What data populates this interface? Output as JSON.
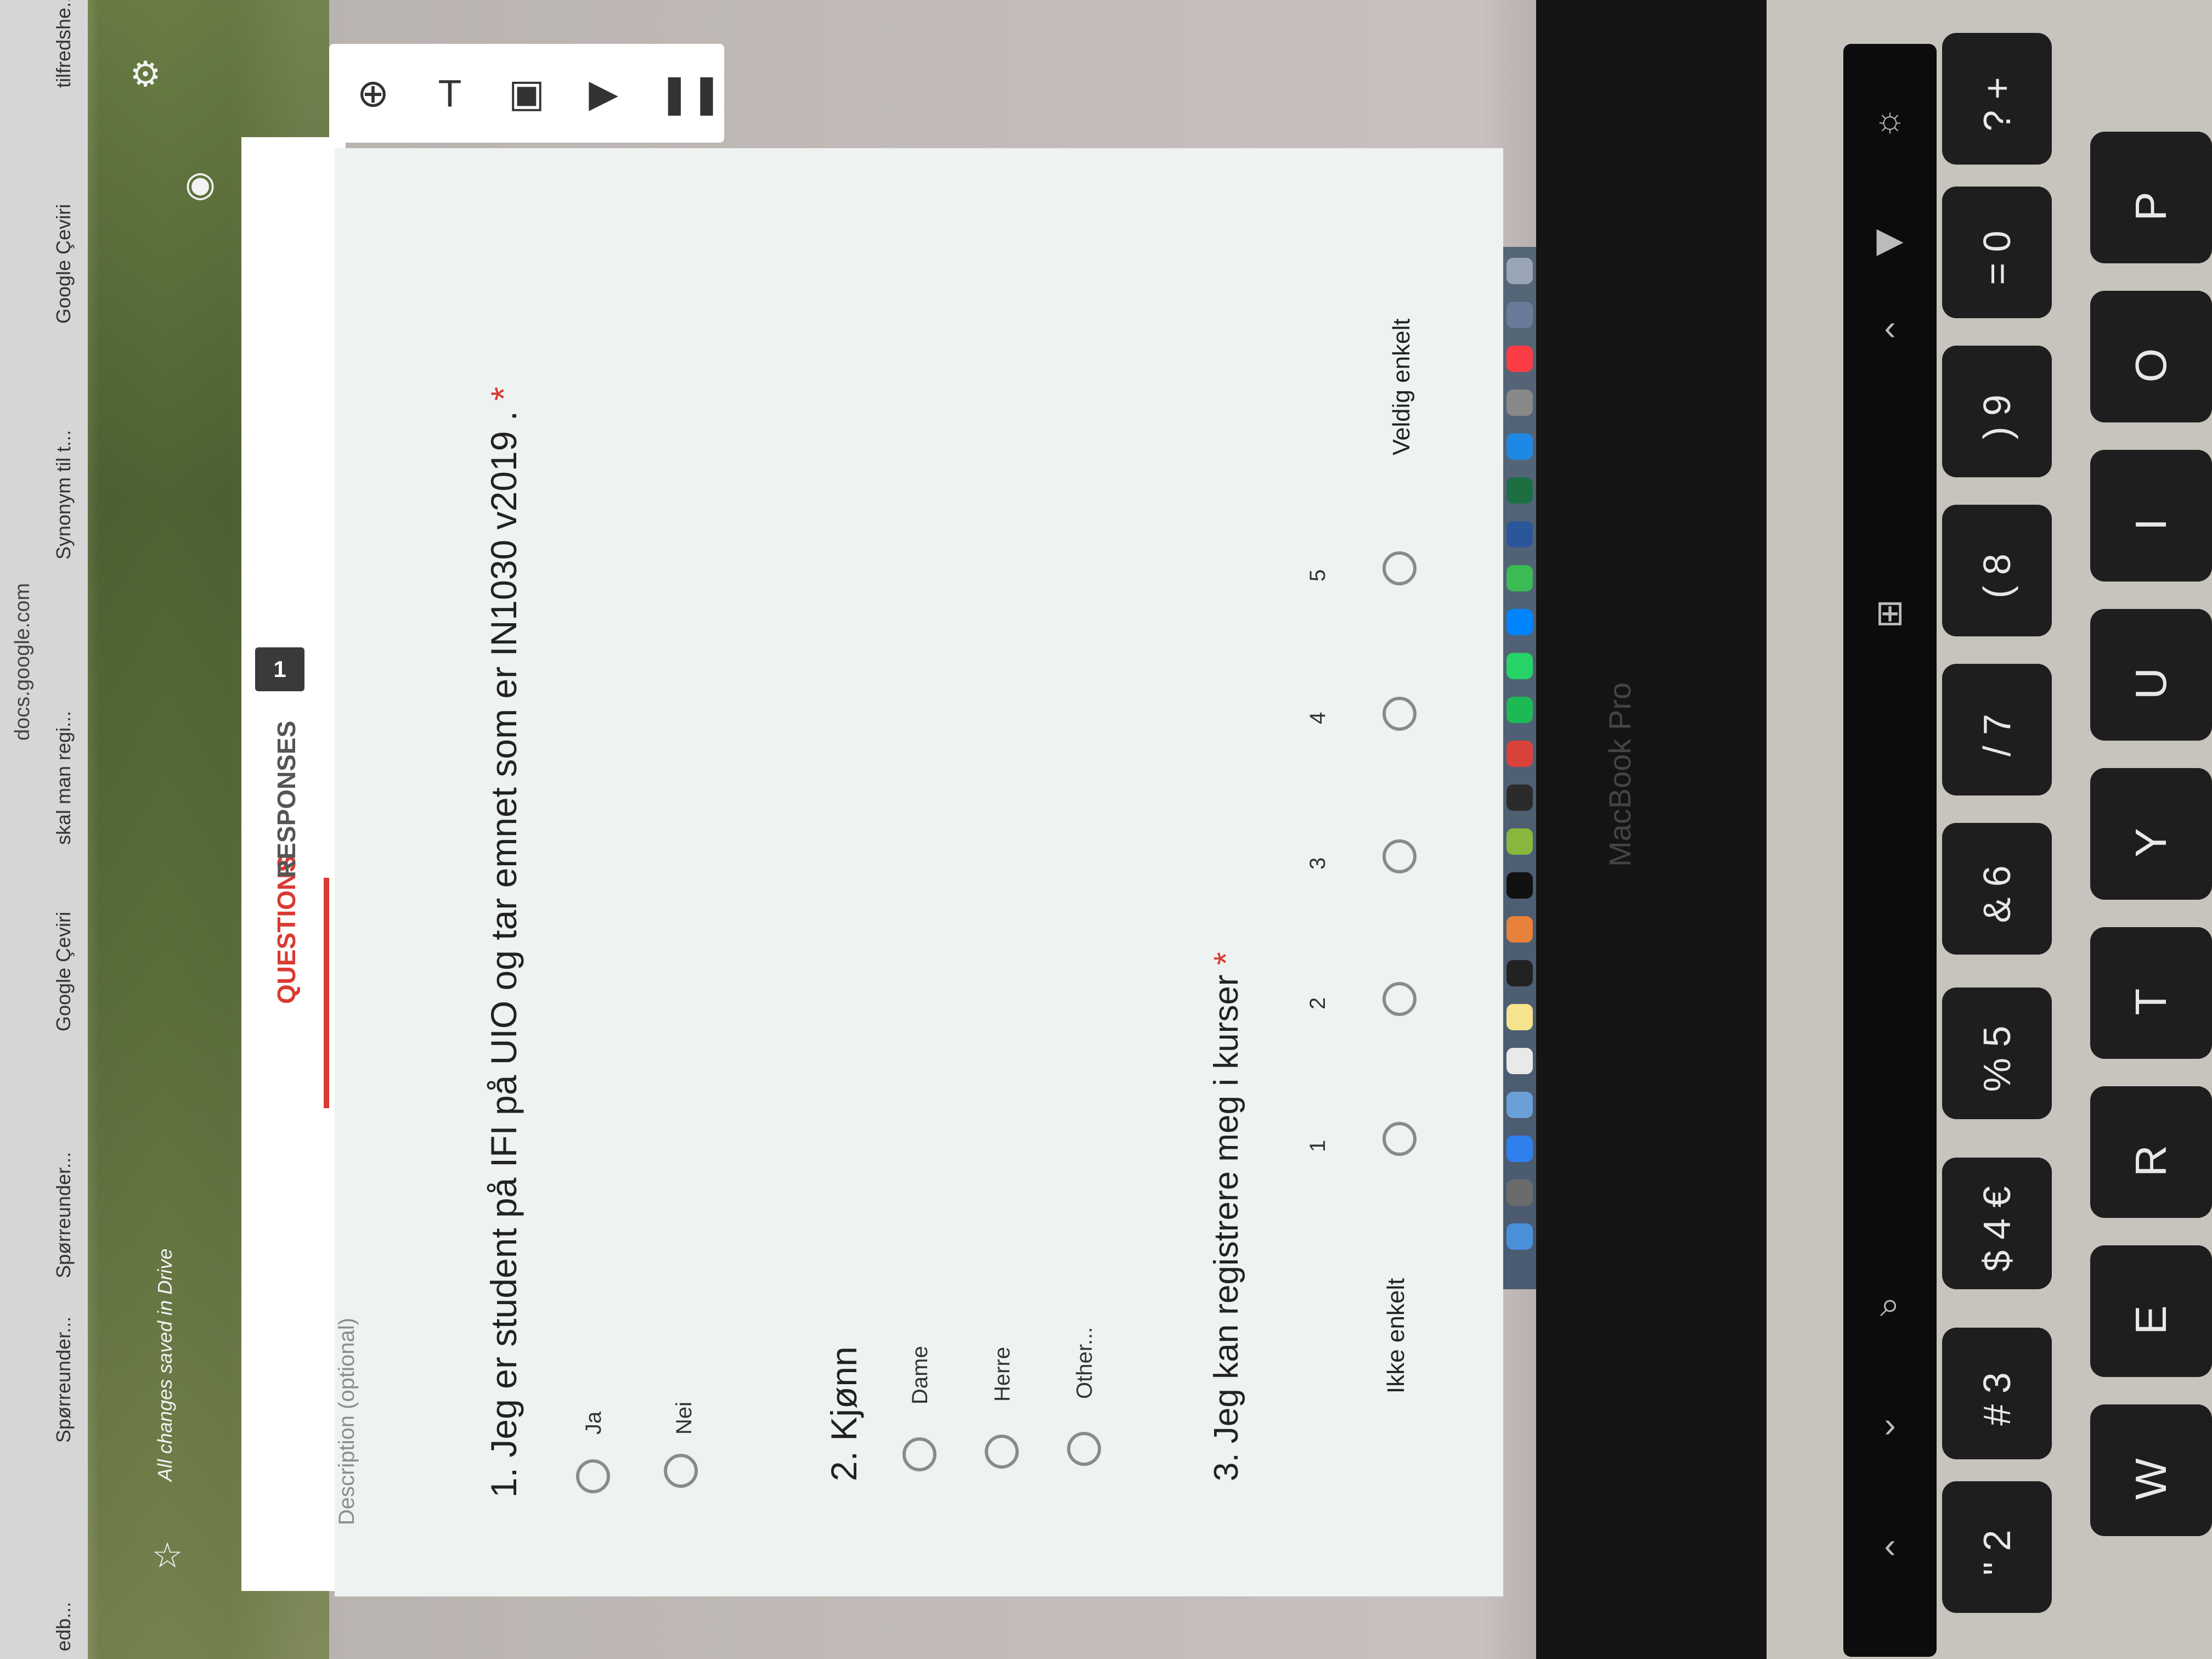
{
  "browser": {
    "tabs": [
      "edb...",
      "Spørreunder...",
      "Spørreunder...",
      "Google Çeviri",
      "skal man regi...",
      "Synonym til t...",
      "Google Çeviri",
      "tilfredshe..."
    ],
    "url": "docs.google.com",
    "saved_note": "All changes saved in Drive"
  },
  "form": {
    "tabs": {
      "questions": "QUESTIONS",
      "responses": "RESPONSES",
      "responses_count": "1"
    },
    "description_placeholder": "Description (optional)",
    "questions": [
      {
        "title": "1. Jeg er student på IFI på UIO og tar emnet som er IN1030 v2019 .",
        "required_mark": "*",
        "options": [
          "Ja",
          "Nei"
        ]
      },
      {
        "title": "2. Kjønn",
        "options": [
          "Dame",
          "Herre",
          "Other..."
        ]
      },
      {
        "title": "3. Jeg kan registrere meg i kurser",
        "required_mark": "*",
        "scale": [
          "1",
          "2",
          "3",
          "4",
          "5"
        ],
        "low_label": "Ikke enkelt",
        "high_label": "Veldig enkelt"
      }
    ]
  },
  "toolbar": {
    "icons": [
      "add-question-icon",
      "title-text-icon",
      "image-icon",
      "video-icon",
      "section-icon"
    ]
  },
  "header_icons": [
    "settings-gear-icon",
    "preview-eye-icon",
    "palette-icon"
  ],
  "laptop": {
    "brand": "MacBook Pro",
    "keys_top": [
      "\"\n2",
      "#\n3",
      "$\n4 €",
      "%\n5",
      "&\n6",
      "/\n7",
      "(\n8",
      ")\n9",
      "=\n0",
      "?\n+"
    ],
    "keys_bottom": [
      "W",
      "E",
      "R",
      "T",
      "Y",
      "U",
      "I",
      "O",
      "P"
    ]
  }
}
